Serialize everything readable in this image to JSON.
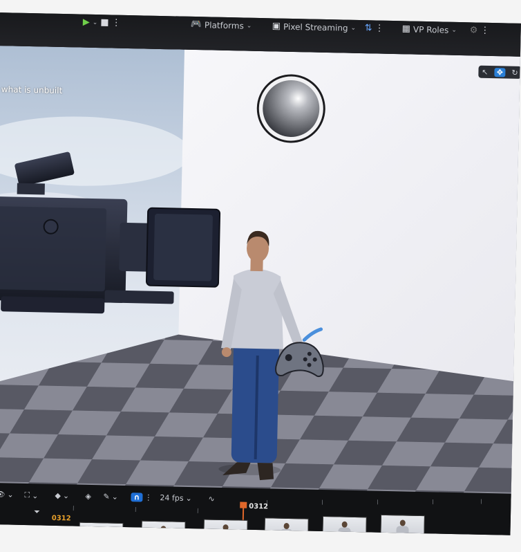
{
  "toolbar": {
    "platforms_label": "Platforms",
    "pixel_streaming_label": "Pixel Streaming",
    "vp_roles_label": "VP Roles"
  },
  "viewport": {
    "status_text": "what is unbuilt"
  },
  "timeline": {
    "fps_label": "24 fps",
    "current_frame": "0312",
    "current_frame_left": "0312"
  },
  "colors": {
    "accent_blue": "#2a7fd6",
    "playhead_orange": "#e0672a",
    "grid_dark": "#4a4b57",
    "grid_light": "#7e7f8c"
  }
}
